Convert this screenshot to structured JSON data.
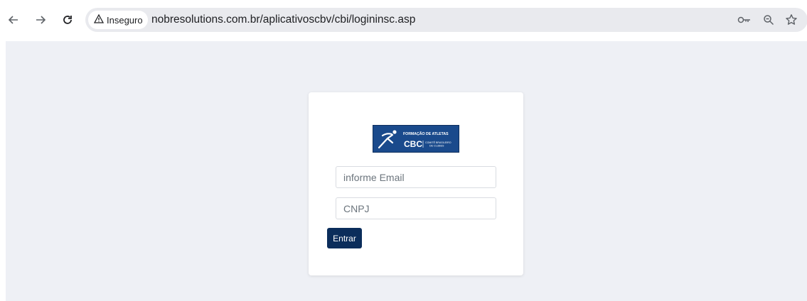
{
  "browser": {
    "back_icon": "arrow-left-icon",
    "forward_icon": "arrow-right-icon",
    "reload_icon": "reload-icon",
    "security_label": "Inseguro",
    "url": "nobresolutions.com.br/aplicativoscbv/cbi/logininsc.asp",
    "right_icons": [
      "key-icon",
      "zoom-icon",
      "star-icon"
    ]
  },
  "login": {
    "logo": {
      "line1": "FORMAÇÃO DE ATLETAS",
      "brand": "CBC",
      "line2": "COMITÊ BRASILEIRO",
      "line3": "DE CLUBES"
    },
    "email_placeholder": "informe Email",
    "cnpj_placeholder": "CNPJ",
    "submit_label": "Entrar"
  },
  "colors": {
    "page_background": "#eef0f5",
    "button": "#0b2d5b",
    "logo_background": "#1a4a8c"
  }
}
